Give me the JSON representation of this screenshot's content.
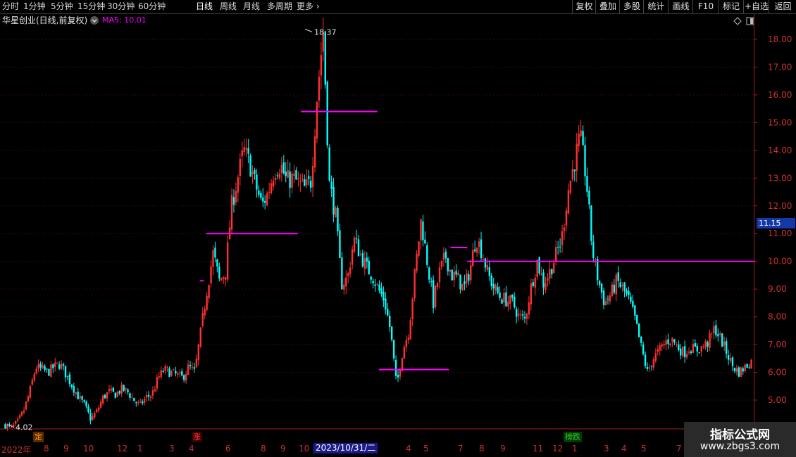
{
  "toolbar": {
    "periods": [
      "分时",
      "1分钟",
      "5分钟",
      "15分钟",
      "30分钟",
      "60分钟",
      "日线",
      "周线",
      "月线",
      "多周期",
      "更多"
    ],
    "active_period": "日线",
    "more_arrow": "›",
    "actions": [
      "复权",
      "叠加",
      "多股",
      "统计",
      "画线",
      "F10",
      "标记",
      "+自选",
      "返回"
    ]
  },
  "header": {
    "stock_title": "华星创业(日线,前复权)",
    "ma_label": "MA5: 10.01",
    "icons": [
      "diamond-icon",
      "window-icon"
    ]
  },
  "price_axis": {
    "ticks": [
      "18.00",
      "17.00",
      "16.00",
      "15.00",
      "14.00",
      "13.00",
      "12.00",
      "11.00",
      "10.00",
      "9.00",
      "8.00",
      "7.00",
      "6.00",
      "5.00"
    ],
    "current_price": "11.15"
  },
  "annotations": {
    "high_label": "18.37",
    "low_label": "4.02"
  },
  "time_axis": {
    "labels": [
      "2022年",
      "8",
      "9",
      "10",
      "12",
      "1",
      "3",
      "4",
      "6",
      "8",
      "9",
      "10",
      "2",
      "4",
      "5",
      "7",
      "8",
      "9",
      "11",
      "12",
      "1",
      "3",
      "4",
      "5",
      "7"
    ],
    "cursor_date": "2023/10/31/二"
  },
  "flags": [
    {
      "text": "定",
      "color": "#ff9900"
    },
    {
      "text": "涨",
      "color": "#ff4444"
    },
    {
      "text": "榜跌",
      "color": "#33cc33"
    }
  ],
  "watermark": {
    "line1": "指标公式网",
    "line2": "www.zbgs3.com"
  },
  "chart_data": {
    "type": "candlestick",
    "series": [
      {
        "type": "price_path",
        "values": [
          4.1,
          4.0,
          4.2,
          4.6,
          5.3,
          6.2,
          6.1,
          6.0,
          6.2,
          6.3,
          5.9,
          5.5,
          5.1,
          4.8,
          4.3,
          4.6,
          5.1,
          5.3,
          5.2,
          5.4,
          5.3,
          5.0,
          4.8,
          5.1,
          5.2,
          5.8,
          6.1,
          6.0,
          5.9,
          5.8,
          6.2,
          6.0,
          7.5,
          9.0,
          10.3,
          9.3,
          9.6,
          12.0,
          13.0,
          14.0,
          13.5,
          12.7,
          12.0,
          12.5,
          13.3,
          13.5,
          12.9,
          13.0,
          12.8,
          12.6,
          12.9,
          16.0,
          18.3,
          12.8,
          11.7,
          9.2,
          9.4,
          10.8,
          10.3,
          9.8,
          9.5,
          9.0,
          8.6,
          7.5,
          5.5,
          6.8,
          7.5,
          9.6,
          11.5,
          10.0,
          8.5,
          9.6,
          10.2,
          9.5,
          9.4,
          9.0,
          9.7,
          10.9,
          10.3,
          9.5,
          9.0,
          8.7,
          8.6,
          8.5,
          8.0,
          7.9,
          9.1,
          10.0,
          9.2,
          9.6,
          10.2,
          10.8,
          12.5,
          13.5,
          14.5,
          13.0,
          10.4,
          9.3,
          8.5,
          8.8,
          9.3,
          9.0,
          8.6,
          7.9,
          6.9,
          6.0,
          6.5,
          6.8,
          7.1,
          7.2,
          6.9,
          6.7,
          6.9,
          6.8,
          6.9,
          7.1,
          7.6,
          7.2,
          6.7,
          6.2,
          6.0,
          6.2,
          6.4
        ]
      },
      {
        "type": "horizontal_segments",
        "color": "#ff00ff",
        "segments": [
          {
            "y": 9.3,
            "x_start": 0.251,
            "x_end": 0.256
          },
          {
            "y": 11.0,
            "x_start": 0.259,
            "x_end": 0.374
          },
          {
            "y": 15.4,
            "x_start": 0.378,
            "x_end": 0.474
          },
          {
            "y": 6.1,
            "x_start": 0.476,
            "x_end": 0.564
          },
          {
            "y": 10.5,
            "x_start": 0.566,
            "x_end": 0.587
          },
          {
            "y": 10.0,
            "x_start": 0.587,
            "x_end": 0.948
          }
        ]
      }
    ],
    "ylim": [
      4.0,
      18.5
    ],
    "colors": {
      "up": "#ff3030",
      "down": "#00ffff",
      "grid": "#5a1010",
      "axis": "#a02020"
    }
  }
}
